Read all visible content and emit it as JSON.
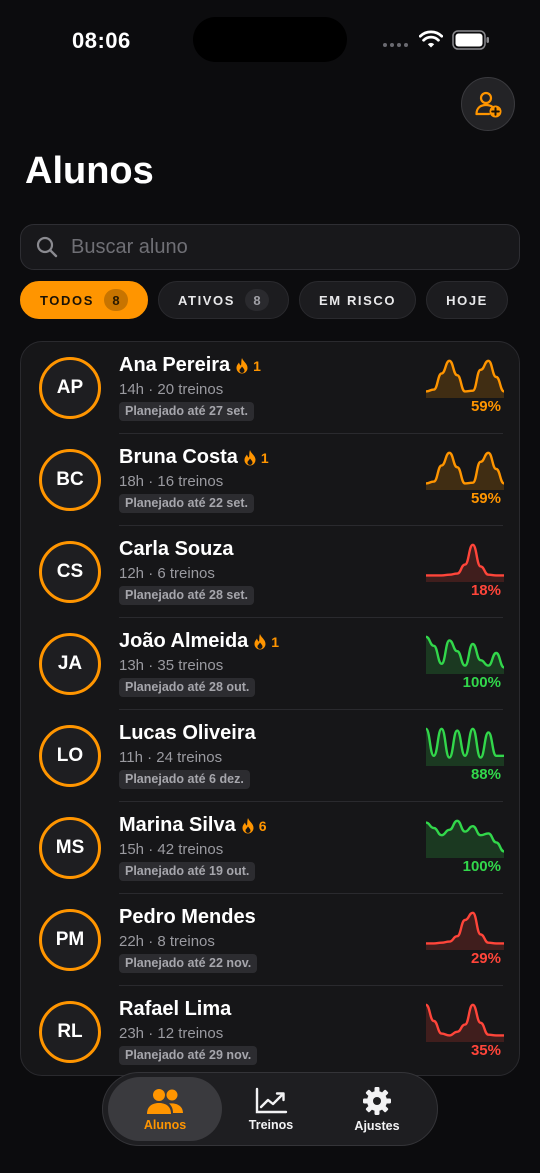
{
  "status_bar": {
    "time": "08:06"
  },
  "header": {
    "title": "Alunos",
    "add_icon": "person-add-icon"
  },
  "search": {
    "placeholder": "Buscar aluno",
    "value": ""
  },
  "filters": [
    {
      "label": "TODOS",
      "count": "8",
      "active": true
    },
    {
      "label": "ATIVOS",
      "count": "8",
      "active": false
    },
    {
      "label": "EM RISCO",
      "count": "",
      "active": false
    },
    {
      "label": "HOJE",
      "count": "",
      "active": false
    }
  ],
  "students": [
    {
      "initials": "AP",
      "name": "Ana Pereira",
      "streak": "1",
      "meta": "14h · 20 treinos",
      "plan": "Planejado até 27 set.",
      "percent": "59%",
      "trend": "orange",
      "spark": [
        0.1,
        0.15,
        0.6,
        0.95,
        0.55,
        0.1,
        0.12,
        0.7,
        0.95,
        0.5,
        0.1
      ]
    },
    {
      "initials": "BC",
      "name": "Bruna Costa",
      "streak": "1",
      "meta": "18h · 16 treinos",
      "plan": "Planejado até 22 set.",
      "percent": "59%",
      "trend": "orange",
      "spark": [
        0.1,
        0.15,
        0.6,
        0.95,
        0.55,
        0.1,
        0.12,
        0.7,
        0.95,
        0.5,
        0.1
      ]
    },
    {
      "initials": "CS",
      "name": "Carla Souza",
      "streak": "",
      "meta": "12h · 6 treinos",
      "plan": "Planejado até 28 set.",
      "percent": "18%",
      "trend": "red",
      "spark": [
        0.1,
        0.1,
        0.1,
        0.12,
        0.15,
        0.4,
        0.95,
        0.35,
        0.12,
        0.1,
        0.1
      ]
    },
    {
      "initials": "JA",
      "name": "João Almeida",
      "streak": "1",
      "meta": "13h · 35 treinos",
      "plan": "Planejado até 28 out.",
      "percent": "100%",
      "trend": "green",
      "spark": [
        0.95,
        0.7,
        0.2,
        0.85,
        0.55,
        0.15,
        0.75,
        0.3,
        0.15,
        0.5,
        0.1
      ]
    },
    {
      "initials": "LO",
      "name": "Lucas Oliveira",
      "streak": "",
      "meta": "11h · 24 treinos",
      "plan": "Planejado até 6 dez.",
      "percent": "88%",
      "trend": "green",
      "spark": [
        0.95,
        0.2,
        0.95,
        0.15,
        0.9,
        0.2,
        0.95,
        0.15,
        0.85,
        0.2,
        0.2
      ]
    },
    {
      "initials": "MS",
      "name": "Marina Silva",
      "streak": "6",
      "meta": "15h · 42 treinos",
      "plan": "Planejado até 19 out.",
      "percent": "100%",
      "trend": "green",
      "spark": [
        0.9,
        0.75,
        0.55,
        0.7,
        0.95,
        0.65,
        0.8,
        0.55,
        0.6,
        0.35,
        0.1
      ]
    },
    {
      "initials": "PM",
      "name": "Pedro Mendes",
      "streak": "",
      "meta": "22h · 8 treinos",
      "plan": "Planejado até 22 nov.",
      "percent": "29%",
      "trend": "red",
      "spark": [
        0.1,
        0.1,
        0.12,
        0.15,
        0.3,
        0.75,
        0.95,
        0.35,
        0.12,
        0.1,
        0.1
      ]
    },
    {
      "initials": "RL",
      "name": "Rafael Lima",
      "streak": "",
      "meta": "23h · 12 treinos",
      "plan": "Planejado até 29 nov.",
      "percent": "35%",
      "trend": "red",
      "spark": [
        0.95,
        0.5,
        0.15,
        0.1,
        0.2,
        0.4,
        0.95,
        0.45,
        0.12,
        0.1,
        0.1
      ]
    }
  ],
  "tabs": [
    {
      "label": "Alunos",
      "icon": "people-icon",
      "active": true
    },
    {
      "label": "Treinos",
      "icon": "trend-chart-icon",
      "active": false
    },
    {
      "label": "Ajustes",
      "icon": "gear-icon",
      "active": false
    }
  ],
  "colors": {
    "accent": "#ff9500",
    "green": "#32d74b",
    "red": "#ff453a",
    "orange": "#ff9500"
  }
}
